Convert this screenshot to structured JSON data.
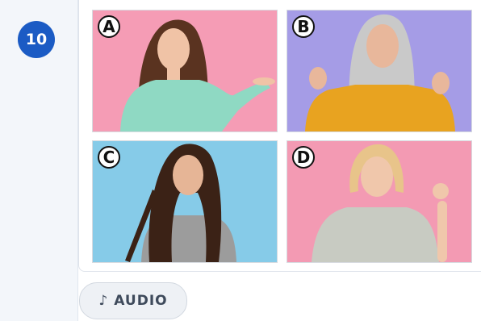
{
  "question": {
    "number": "10"
  },
  "options": [
    {
      "label": "A",
      "background": "#f59cb5",
      "hair": "#5a3320",
      "skin": "#f0c3a6",
      "top": "#8fd9c3",
      "description": "woman with long brown hair in mint sweater presenting with open palm"
    },
    {
      "label": "B",
      "background": "#a59ce6",
      "hair": "#c9c9c9",
      "skin": "#e8b79b",
      "top": "#e8a320",
      "description": "older woman with long grey hair in mustard shirt cheering with fists"
    },
    {
      "label": "C",
      "background": "#86cbe8",
      "hair": "#3b2216",
      "skin": "#e6b596",
      "top": "#9c9c9c",
      "description": "woman with very long dark hair in grey t-shirt holding a strand of hair"
    },
    {
      "label": "D",
      "background": "#f39ab3",
      "hair": "#e8c48a",
      "skin": "#f0c7ab",
      "top": "#c8cbc2",
      "description": "woman with blonde bob in grey t-shirt making OK sign"
    }
  ],
  "audio": {
    "icon": "music-note-icon",
    "label": "AUDIO"
  },
  "colors": {
    "badge": "#1b5bc4",
    "sidebar": "#f3f6fa"
  }
}
